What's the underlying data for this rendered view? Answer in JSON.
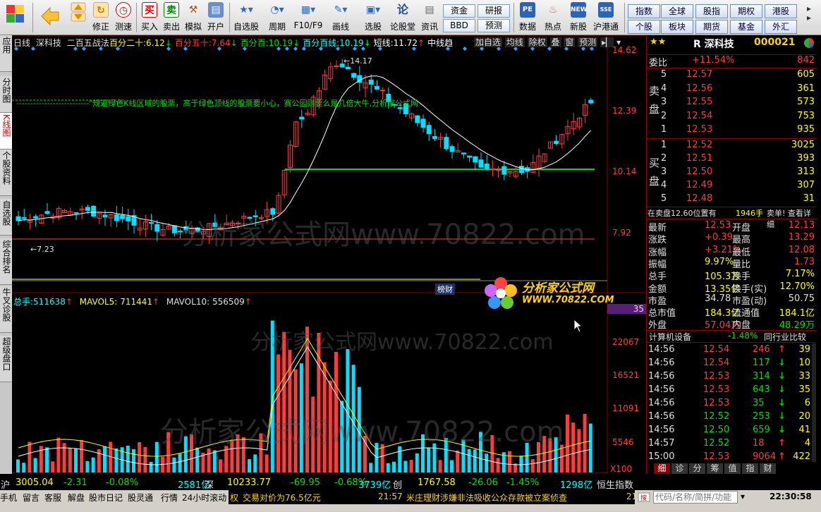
{
  "toolbar": {
    "buttons": [
      {
        "label": "买入",
        "icon": "买"
      },
      {
        "label": "卖出",
        "icon": "卖"
      },
      {
        "label": "模拟",
        "icon": "hammer"
      },
      {
        "label": "开户",
        "icon": "card"
      },
      {
        "label": "自选股",
        "icon": "star"
      },
      {
        "label": "周期",
        "icon": "clock"
      },
      {
        "label": "F10/F9",
        "icon": "doc"
      },
      {
        "label": "画线",
        "icon": "pen"
      },
      {
        "label": "选股",
        "icon": "screen"
      },
      {
        "label": "论股堂",
        "icon": "论"
      },
      {
        "label": "资讯",
        "icon": "news"
      },
      {
        "label": "数据",
        "icon": "PE"
      },
      {
        "label": "热点",
        "icon": "fire"
      },
      {
        "label": "新股",
        "icon": "new"
      },
      {
        "label": "沪港通",
        "icon": "hk"
      }
    ],
    "nav_labels": [
      "后退",
      "修正",
      "测速"
    ],
    "small_buttons": [
      "资金",
      "BBD",
      "研报",
      "预测"
    ],
    "right_buttons": [
      "指数",
      "全球",
      "股指",
      "期权",
      "港股",
      "个股",
      "板块",
      "期货",
      "基金",
      "外汇"
    ]
  },
  "left_tabs": [
    "应用",
    "分时图",
    "K线图",
    "个股资料",
    "自选股",
    "综合排名",
    "牛叉诊股",
    "超级盘口"
  ],
  "chart_header": {
    "period": "日线",
    "stock": "深科技",
    "indicator": "二百五战法",
    "items": [
      {
        "label": "百分二十:",
        "value": "6.12",
        "arrow": "↓",
        "color": "#ffff00"
      },
      {
        "label": "百分五十:",
        "value": "7.64",
        "arrow": "↓",
        "color": "#ff3b3b"
      },
      {
        "label": "百分百:",
        "value": "10.19",
        "arrow": "↓",
        "color": "#00e000"
      },
      {
        "label": "百分百线:",
        "value": "10.19",
        "arrow": "↓",
        "color": "#00ffff"
      },
      {
        "label": "短线:",
        "value": "11.72",
        "arrow": "↑",
        "color": "#ffffff"
      },
      {
        "label": "中线趋",
        "value": "",
        "arrow": "",
        "color": "#ffffff"
      }
    ],
    "buttons": [
      "加自选",
      "均线",
      "除权",
      "叠",
      "窗",
      "预测"
    ]
  },
  "chart_annotation": "--------------------------\"规避绿色K线区域的股票，高于绿色顶线的股票要小心，赛公园则要么是几倍大牛,分析家公式网",
  "price_axis": [
    "14.62",
    "12.39",
    "10.14",
    "7.92"
  ],
  "price_marks": {
    "high": "14.17",
    "low": "7.23"
  },
  "volume_header": {
    "label": "总手:",
    "value": "511638",
    "mavol5_label": "MAVOL5:",
    "mavol5": "711441",
    "mavol10_label": "MAVOL10:",
    "mavol10": "556509"
  },
  "volume_axis": [
    "22067",
    "16521",
    "11091",
    "5546",
    "X100"
  ],
  "volume_axis_badge": "35",
  "watermark": "分析家公式网www.70822.com",
  "logo": {
    "title": "分析家公式网",
    "url": "WWW.70822.COM"
  },
  "tab_label": "榜财",
  "quote": {
    "name": "R 深科技",
    "code": "000021",
    "weibi_label": "委比",
    "weibi": "+11.54%",
    "weibi_diff": "842",
    "sell_label": "卖盘",
    "buy_label": "买盘",
    "sell": [
      {
        "lvl": "5",
        "price": "12.57",
        "vol": "605"
      },
      {
        "lvl": "4",
        "price": "12.56",
        "vol": "361"
      },
      {
        "lvl": "3",
        "price": "12.55",
        "vol": "573"
      },
      {
        "lvl": "2",
        "price": "12.54",
        "vol": "753"
      },
      {
        "lvl": "1",
        "price": "12.53",
        "vol": "935"
      }
    ],
    "buy": [
      {
        "lvl": "1",
        "price": "12.52",
        "vol": "3025"
      },
      {
        "lvl": "2",
        "price": "12.51",
        "vol": "393"
      },
      {
        "lvl": "3",
        "price": "12.50",
        "vol": "313"
      },
      {
        "lvl": "4",
        "price": "12.49",
        "vol": "307"
      },
      {
        "lvl": "5",
        "price": "12.48",
        "vol": "31"
      }
    ],
    "sell_note": "在卖盘12.60位置有",
    "sell_note_vol": "1946手",
    "sell_note_links": "卖单! 查看详细",
    "stats": [
      {
        "l1": "最新",
        "v1": "12.53",
        "c1": "red",
        "l2": "开盘",
        "v2": "12.13",
        "c2": "red"
      },
      {
        "l1": "涨跌",
        "v1": "+0.39",
        "c1": "red",
        "l2": "最高",
        "v2": "13.29",
        "c2": "red"
      },
      {
        "l1": "涨幅",
        "v1": "+3.21%",
        "c1": "red",
        "l2": "最低",
        "v2": "12.08",
        "c2": "red"
      },
      {
        "l1": "振幅",
        "v1": "9.97%",
        "c1": "yel",
        "l2": "量比",
        "v2": "1.73",
        "c2": "red"
      },
      {
        "l1": "总手",
        "v1": "105.3万",
        "c1": "yel",
        "l2": "换手",
        "v2": "7.17%",
        "c2": "yel"
      },
      {
        "l1": "金额",
        "v1": "13.35亿",
        "c1": "yel",
        "l2": "换手(实)",
        "v2": "12.70%",
        "c2": "yel"
      },
      {
        "l1": "市盈",
        "v1": "34.78",
        "c1": "wht",
        "l2": "市盈(动)",
        "v2": "50.75",
        "c2": "wht"
      },
      {
        "l1": "总市值",
        "v1": "184.3亿",
        "c1": "yel",
        "l2": "流通值",
        "v2": "184.1亿",
        "c2": "yel"
      },
      {
        "l1": "外盘",
        "v1": "57.04万",
        "c1": "red",
        "l2": "内盘",
        "v2": "48.29万",
        "c2": "green"
      }
    ],
    "sector": "计算机设备",
    "sector_change": "-1.48%",
    "sector_compare": "同行业比较",
    "ticks": [
      {
        "time": "14:56",
        "price": "12.54",
        "vol": "246",
        "dir": "↑",
        "n": "39"
      },
      {
        "time": "14:56",
        "price": "12.54",
        "vol": "117",
        "dir": "↓",
        "n": "10"
      },
      {
        "time": "14:56",
        "price": "12.53",
        "vol": "314",
        "dir": "↓",
        "n": "33"
      },
      {
        "time": "14:56",
        "price": "12.53",
        "vol": "643",
        "dir": "↓",
        "n": "35"
      },
      {
        "time": "14:56",
        "price": "12.53",
        "vol": "35",
        "dir": "↓",
        "n": "6"
      },
      {
        "time": "14:56",
        "price": "12.52",
        "vol": "253",
        "dir": "↓",
        "n": "20"
      },
      {
        "time": "14:56",
        "price": "12.50",
        "vol": "659",
        "dir": "↓",
        "n": "41"
      },
      {
        "time": "14:57",
        "price": "12.52",
        "vol": "18",
        "dir": "↑",
        "n": "4"
      },
      {
        "time": "15:00",
        "price": "12.53",
        "vol": "9064",
        "dir": "↑",
        "n": "422"
      }
    ],
    "bottom_tabs": [
      "细",
      "诊",
      "分",
      "筹",
      "值",
      "指",
      "财"
    ]
  },
  "index_bar": [
    {
      "text": "沪",
      "color": "wht"
    },
    {
      "text": "3005.04",
      "color": "yel"
    },
    {
      "text": "-2.31",
      "color": "green"
    },
    {
      "text": "-0.08%",
      "color": "green"
    },
    {
      "text": "2581亿",
      "color": "cyan"
    },
    {
      "text": "深",
      "color": "wht"
    },
    {
      "text": "10233.77",
      "color": "yel"
    },
    {
      "text": "-69.95",
      "color": "green"
    },
    {
      "text": "-0.68%",
      "color": "green"
    },
    {
      "text": "3739亿",
      "color": "cyan"
    },
    {
      "text": "创",
      "color": "wht"
    },
    {
      "text": "1767.58",
      "color": "yel"
    },
    {
      "text": "-26.06",
      "color": "green"
    },
    {
      "text": "-1.45%",
      "color": "green"
    },
    {
      "text": "1298亿",
      "color": "cyan"
    },
    {
      "text": "恒生指数",
      "color": "wht"
    }
  ],
  "status_bar": {
    "items": [
      "手机",
      "留言",
      "客服",
      "解盘",
      "股市日记",
      "股灵通",
      "行情",
      "24小时滚动"
    ],
    "news1_prefix": "权",
    "news1": "交易对价为76.5亿元",
    "news2_time": "21:57",
    "news2": "米庄理财涉嫌非法吸收公众存款被立案侦查",
    "news3": "21",
    "search_placeholder": "代码/名称/简拼/功能",
    "clock": "22:30:58"
  }
}
